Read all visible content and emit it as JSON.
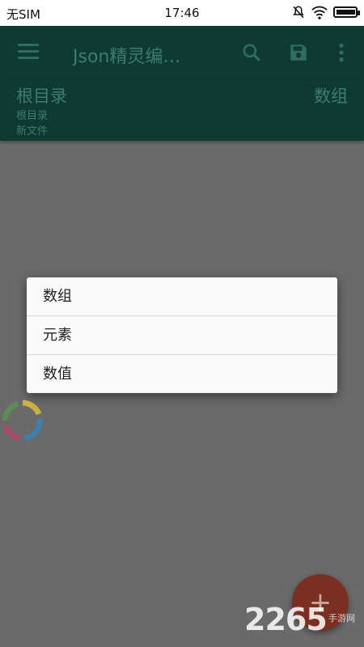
{
  "status_bar": {
    "carrier": "无SIM",
    "time": "17:46",
    "icons": [
      "mute-bell-icon",
      "wifi-icon",
      "battery-icon"
    ]
  },
  "app_bar": {
    "menu_icon": "menu-icon",
    "title": "Json精灵编…",
    "actions": [
      "search-icon",
      "save-icon",
      "more-vert-icon"
    ]
  },
  "breadcrumb": {
    "root_label": "根目录",
    "path": "根目录",
    "file": "新文件",
    "type_label": "数组"
  },
  "popup_menu": {
    "items": [
      {
        "label": "数组"
      },
      {
        "label": "元素"
      },
      {
        "label": "数值"
      }
    ]
  },
  "fab": {
    "label": "+",
    "icon": "add-icon"
  },
  "watermark": {
    "main": "2265",
    "sub": "手游网"
  },
  "colors": {
    "scrim": "#6a6a6a",
    "toolbar": "#0e3a31",
    "toolbar_text": "#3d7c70",
    "fab": "#7a2f22"
  }
}
